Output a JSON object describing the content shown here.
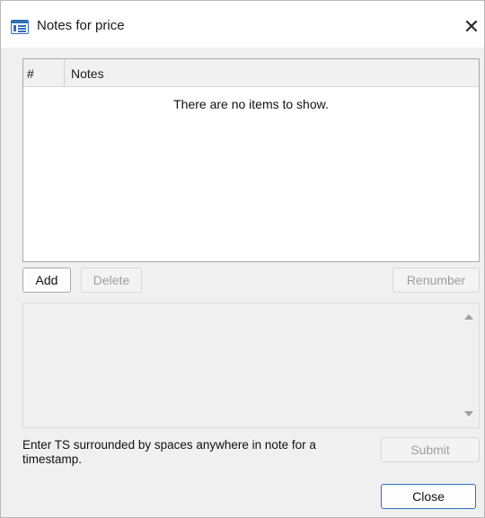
{
  "window": {
    "title": "Notes for price",
    "title_icon": "form-window-icon",
    "close_glyph": "✕"
  },
  "list": {
    "columns": [
      "#",
      "Notes"
    ],
    "rows": [],
    "empty_message": "There are no items to show."
  },
  "buttons": {
    "add": "Add",
    "delete": "Delete",
    "renumber": "Renumber",
    "submit": "Submit",
    "close": "Close"
  },
  "note_editor": {
    "value": ""
  },
  "hint_text": "Enter TS surrounded by spaces anywhere in note for a timestamp.",
  "colors": {
    "accent": "#2b6fc9",
    "disabled_text": "#9d9d9d"
  }
}
